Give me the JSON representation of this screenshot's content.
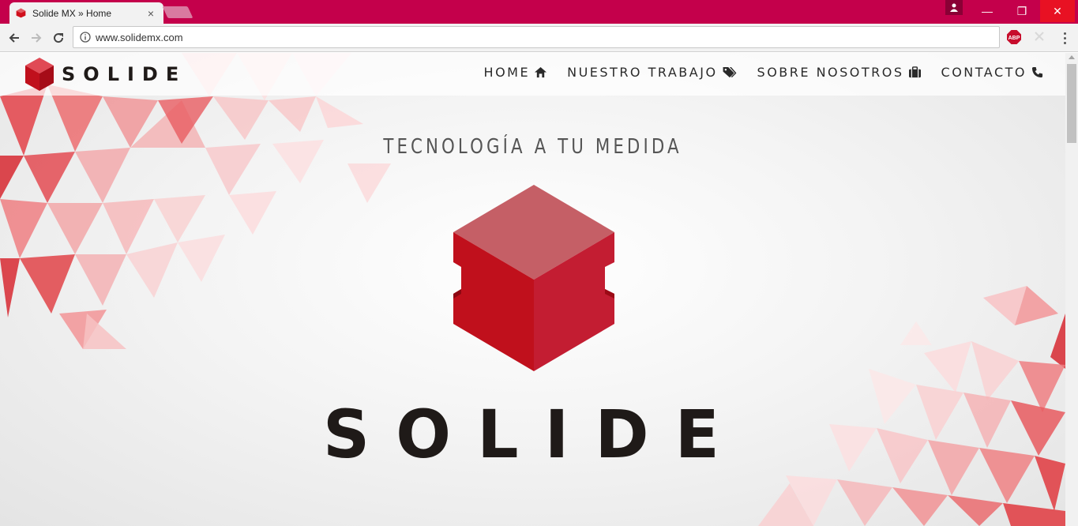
{
  "browser": {
    "tab_title": "Solide MX » Home",
    "tab_close": "×",
    "url": "www.solidemx.com",
    "window_controls": {
      "minimize": "—",
      "restore": "❐",
      "close": "✕"
    },
    "extension": "ABP"
  },
  "site": {
    "logo_text": "SOLIDE",
    "nav": [
      {
        "label": "HOME",
        "icon": "home-icon"
      },
      {
        "label": "NUESTRO TRABAJO",
        "icon": "tags-icon"
      },
      {
        "label": "SOBRE NOSOTROS",
        "icon": "briefcase-icon"
      },
      {
        "label": "CONTACTO",
        "icon": "phone-icon"
      }
    ],
    "tagline": "TECNOLOGÍA A TU MEDIDA",
    "hero_word": "SOLIDE"
  },
  "colors": {
    "brand_red": "#c0101c",
    "chrome_accent": "#c4004b",
    "text_dark": "#1f1a18"
  }
}
